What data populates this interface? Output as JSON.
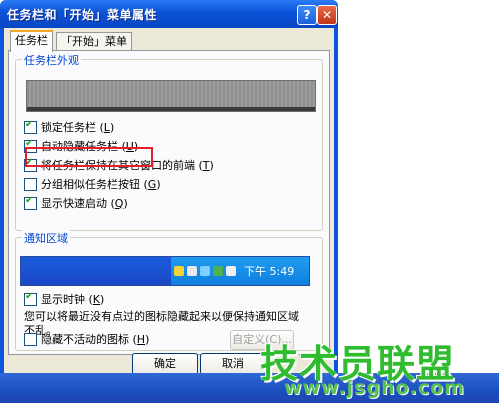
{
  "window": {
    "title": "任务栏和「开始」菜单属性",
    "help_glyph": "?",
    "close_glyph": "✕"
  },
  "tabs": [
    {
      "label": "任务栏",
      "active": true
    },
    {
      "label": "「开始」菜单",
      "active": false
    }
  ],
  "appearance_group": {
    "title": "任务栏外观",
    "options": [
      {
        "label": "锁定任务栏",
        "key": "L",
        "checked": true
      },
      {
        "label": "自动隐藏任务栏",
        "key": "U",
        "checked": true
      },
      {
        "label": "将任务栏保持在其它窗口的前端",
        "key": "T",
        "checked": true
      },
      {
        "label": "分组相似任务栏按钮",
        "key": "G",
        "checked": false
      },
      {
        "label": "显示快速启动",
        "key": "Q",
        "checked": true
      }
    ]
  },
  "notification_group": {
    "title": "通知区域",
    "tray_time": "下午 5:49",
    "show_clock": {
      "label": "显示时钟",
      "key": "K",
      "checked": true
    },
    "description": "您可以将最近没有点过的图标隐藏起来以便保持通知区域不乱。",
    "hide_inactive": {
      "label": "隐藏不活动的图标",
      "key": "H",
      "checked": false
    },
    "customize_label": "自定义(C)..."
  },
  "buttons": {
    "ok": "确定",
    "cancel": "取消"
  },
  "watermark": {
    "brand": "技术员联盟",
    "url": "www.jsgho.com"
  },
  "colors": {
    "highlight_box": "#e5202b",
    "accent_blue": "#0046d5",
    "watermark_green": "#2fbd2f"
  }
}
